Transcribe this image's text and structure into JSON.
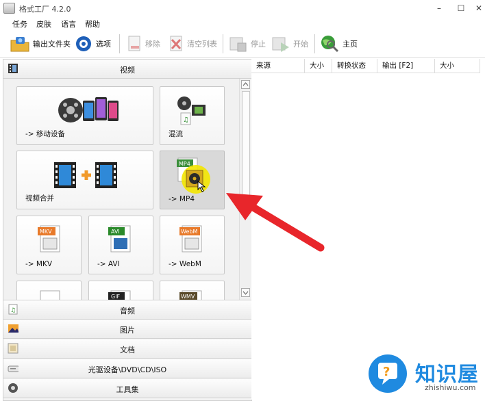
{
  "app": {
    "title": "格式工厂 4.2.0"
  },
  "window_controls": {
    "minimize": "–",
    "maximize": "☐",
    "close": "✕"
  },
  "menu": [
    "任务",
    "皮肤",
    "语言",
    "帮助"
  ],
  "toolbar": {
    "output_folder": "输出文件夹",
    "options": "选项",
    "remove": "移除",
    "clear_list": "清空列表",
    "stop": "停止",
    "start": "开始",
    "home": "主页"
  },
  "categories": {
    "video": "视频",
    "audio": "音频",
    "image": "图片",
    "document": "文档",
    "optical": "光驱设备\\DVD\\CD\\ISO",
    "tools": "工具集"
  },
  "tiles": [
    {
      "label": "-> 移动设备",
      "icon": "mobile-device-icon"
    },
    {
      "label": "混流",
      "icon": "mux-icon"
    },
    {
      "label": "视频合并",
      "icon": "video-join-icon"
    },
    {
      "label": "-> MP4",
      "icon": "mp4-file-icon",
      "badge": "MP4"
    },
    {
      "label": "-> MKV",
      "icon": "mkv-file-icon",
      "badge": "MKV"
    },
    {
      "label": "-> AVI",
      "icon": "avi-file-icon",
      "badge": "AVI"
    },
    {
      "label": "-> WebM",
      "icon": "webm-file-icon",
      "badge": "WebM"
    },
    {
      "badge": "GIF"
    },
    {
      "badge": "WMV"
    }
  ],
  "file_list": {
    "columns": [
      "来源",
      "大小",
      "转换状态",
      "输出 [F2]",
      "大小"
    ]
  },
  "watermark": {
    "name": "知识屋",
    "url": "zhishiwu.com"
  },
  "colors": {
    "highlight_tile": "#d9d9d9",
    "arrow": "#e8262b",
    "cursor_halo": "#f3e600"
  }
}
